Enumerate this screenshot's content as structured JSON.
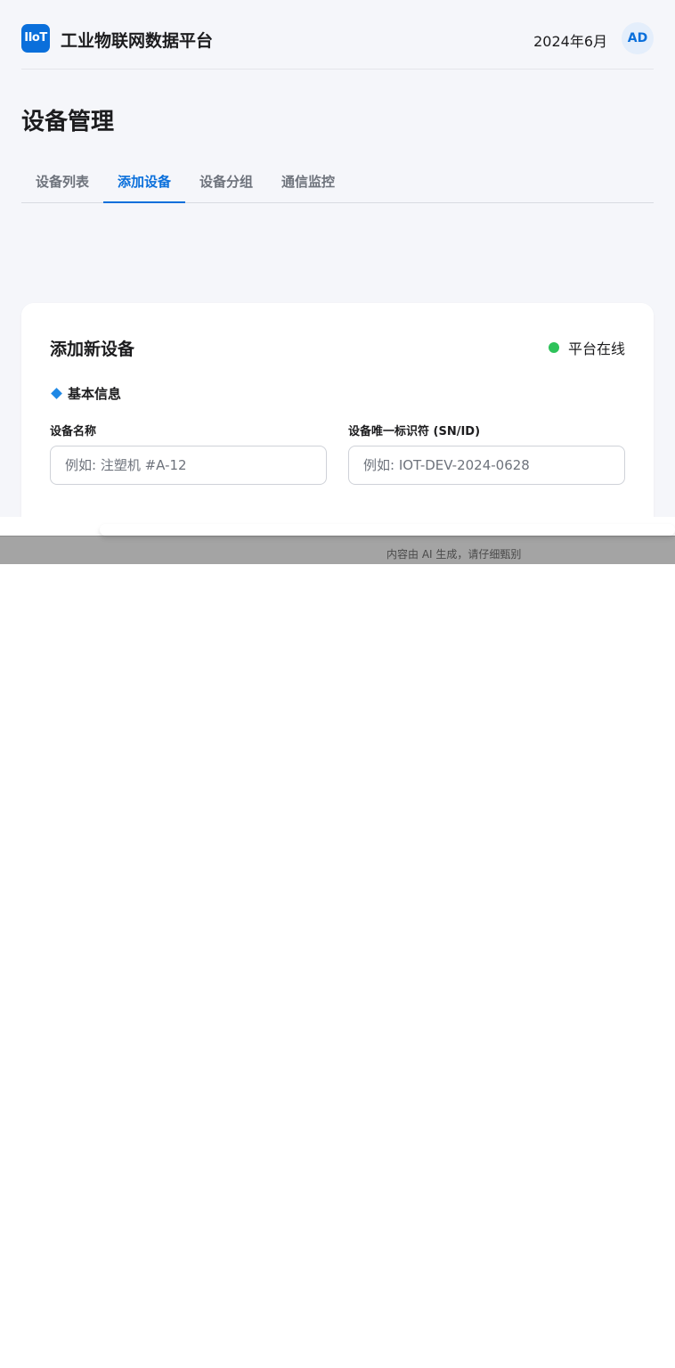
{
  "header": {
    "logo_text": "IIoT",
    "app_title": "工业物联网数据平台",
    "date": "2024年6月",
    "avatar": "AD"
  },
  "page": {
    "title": "设备管理"
  },
  "tabs": [
    {
      "label": "设备列表",
      "active": false
    },
    {
      "label": "添加设备",
      "active": true
    },
    {
      "label": "设备分组",
      "active": false
    },
    {
      "label": "通信监控",
      "active": false
    }
  ],
  "form": {
    "title": "添加新设备",
    "status_label": "平台在线",
    "status_color": "#2ec25a",
    "section_title": "基本信息",
    "section_icon": "blue-diamond-icon",
    "fields": [
      {
        "label": "设备名称",
        "placeholder": "例如: 注塑机 #A-12",
        "value": ""
      },
      {
        "label": "设备唯一标识符 (SN/ID)",
        "placeholder": "例如: IOT-DEV-2024-0628",
        "value": ""
      }
    ]
  },
  "footer": {
    "ai_notice": "内容由 AI 生成，请仔细甄别"
  },
  "colors": {
    "accent": "#0a6fdb",
    "background": "#f5f6fa",
    "online": "#2ec25a"
  }
}
